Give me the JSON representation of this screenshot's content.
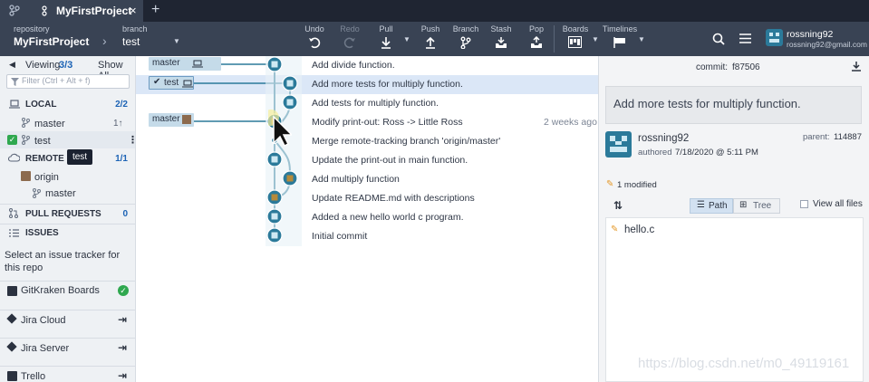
{
  "tab": {
    "title": "MyFirstProject",
    "add_label": "+"
  },
  "toolbar": {
    "repository_label": "repository",
    "repository_name": "MyFirstProject",
    "branch_label": "branch",
    "branch_name": "test",
    "buttons": {
      "undo": "Undo",
      "redo": "Redo",
      "pull": "Pull",
      "push": "Push",
      "branch": "Branch",
      "stash": "Stash",
      "pop": "Pop",
      "boards": "Boards",
      "timelines": "Timelines"
    },
    "user_name": "rossning92",
    "user_email": "rossning92@gmail.com"
  },
  "sidebar": {
    "viewing_label": "Viewing",
    "viewing_count": "3/3",
    "show_all": "Show All",
    "filter_placeholder": "Filter (Ctrl + Alt + f)",
    "local": {
      "label": "LOCAL",
      "count": "2/2",
      "branches": [
        {
          "name": "master",
          "status": "1↑"
        },
        {
          "name": "test",
          "status": ""
        }
      ],
      "tooltip": "test"
    },
    "remote": {
      "label": "REMOTE",
      "count": "1/1",
      "origin": "origin",
      "branch": "master"
    },
    "pull_requests": {
      "label": "PULL REQUESTS",
      "count": "0"
    },
    "issues": {
      "label": "ISSUES",
      "text": "Select an issue tracker for this repo",
      "trackers": [
        "GitKraken Boards",
        "Jira Cloud",
        "Jira Server",
        "Trello"
      ]
    }
  },
  "graph": {
    "branch_tags": [
      {
        "name": "master",
        "row": 0
      },
      {
        "name": "test",
        "row": 1
      },
      {
        "name": "master",
        "row": 3
      }
    ],
    "commits": [
      {
        "message": "Add divide function.",
        "time": ""
      },
      {
        "message": "Add more tests for multiply function.",
        "time": ""
      },
      {
        "message": "Add tests for multiply function.",
        "time": ""
      },
      {
        "message": "Modify print-out: Ross -> Little Ross",
        "time": "2 weeks ago"
      },
      {
        "message": "Merge remote-tracking branch 'origin/master'",
        "time": ""
      },
      {
        "message": "Update the print-out in main function.",
        "time": ""
      },
      {
        "message": "Add multiply function",
        "time": ""
      },
      {
        "message": "Update README.md with descriptions",
        "time": ""
      },
      {
        "message": "Added a new hello world c program.",
        "time": ""
      },
      {
        "message": "Initial commit",
        "time": ""
      }
    ]
  },
  "detail": {
    "commit_label": "commit:",
    "commit_sha": "f87506",
    "message": "Add more tests for multiply function.",
    "author": "rossning92",
    "authored_label": "authored",
    "authored_date": "7/18/2020 @ 5:11 PM",
    "parent_label": "parent:",
    "parent_sha": "114887",
    "modified": "1 modified",
    "path_label": "Path",
    "tree_label": "Tree",
    "view_all": "View all files",
    "file": "hello.c"
  },
  "watermark": "https://blog.csdn.net/m0_49119161",
  "colors": {
    "accent": "#1c63b5",
    "lane": "#2b7a9a",
    "selected_row": "#dbe7f7",
    "check": "#2fa84f"
  }
}
